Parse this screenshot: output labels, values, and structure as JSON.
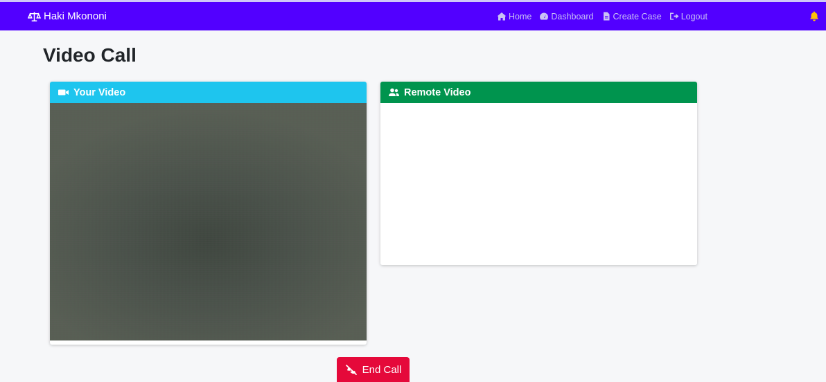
{
  "navbar": {
    "brand": "Haki Mkononi",
    "brand_icon": "scale-balance-icon",
    "links": [
      {
        "label": "Home",
        "icon": "home-icon"
      },
      {
        "label": "Dashboard",
        "icon": "dashboard-gauge-icon"
      },
      {
        "label": "Create Case",
        "icon": "document-icon"
      },
      {
        "label": "Logout",
        "icon": "logout-icon"
      }
    ],
    "notification_icon": "bell-icon",
    "colors": {
      "background": "#5200ff",
      "link": "#c9c2f4",
      "bell": "#ffc107"
    }
  },
  "page": {
    "title": "Video Call"
  },
  "local_video": {
    "header": "Your Video",
    "icon": "video-camera-icon",
    "header_color": "#1ec5ee"
  },
  "remote_video": {
    "header": "Remote Video",
    "icon": "users-icon",
    "header_color": "#00944e"
  },
  "end_call": {
    "label": "End Call",
    "icon": "phone-slash-icon",
    "color": "#e5093a"
  }
}
